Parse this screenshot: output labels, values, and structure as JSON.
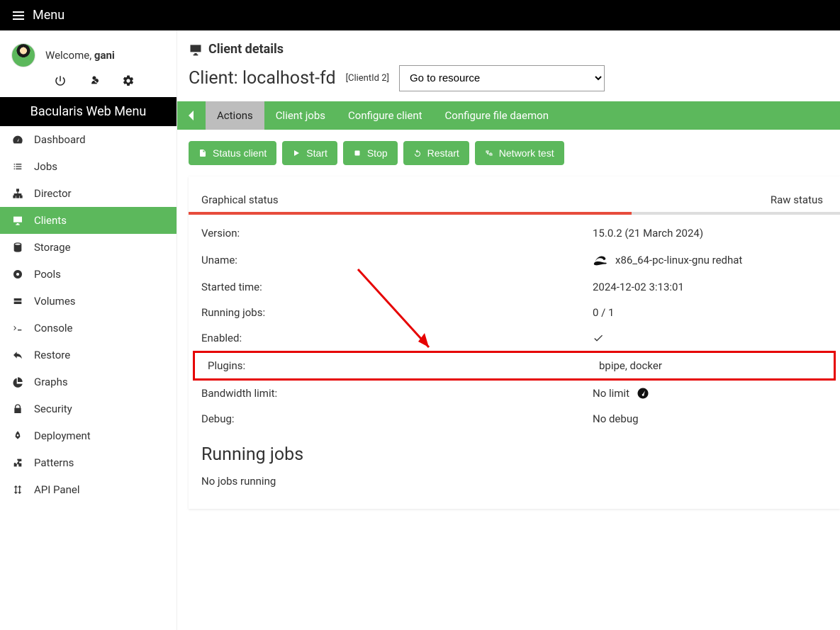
{
  "topbar": {
    "menu_label": "Menu"
  },
  "user": {
    "welcome_prefix": "Welcome, ",
    "name": "gani"
  },
  "sidebar": {
    "menu_title": "Bacularis Web Menu",
    "items": [
      {
        "label": "Dashboard",
        "icon": "tachometer"
      },
      {
        "label": "Jobs",
        "icon": "list"
      },
      {
        "label": "Director",
        "icon": "sitemap"
      },
      {
        "label": "Clients",
        "icon": "desktop",
        "active": true
      },
      {
        "label": "Storage",
        "icon": "database"
      },
      {
        "label": "Pools",
        "icon": "tape"
      },
      {
        "label": "Volumes",
        "icon": "hdd"
      },
      {
        "label": "Console",
        "icon": "terminal"
      },
      {
        "label": "Restore",
        "icon": "reply"
      },
      {
        "label": "Graphs",
        "icon": "chart-pie"
      },
      {
        "label": "Security",
        "icon": "lock"
      },
      {
        "label": "Deployment",
        "icon": "rocket"
      },
      {
        "label": "Patterns",
        "icon": "puzzle"
      },
      {
        "label": "API Panel",
        "icon": "arrows-v"
      }
    ]
  },
  "page": {
    "title": "Client details",
    "client_label": "Client: ",
    "client_name": "localhost-fd",
    "client_id": "[ClientId 2]",
    "go_to_resource": "Go to resource"
  },
  "tabs": {
    "items": [
      {
        "label": "Actions",
        "active": true
      },
      {
        "label": "Client jobs"
      },
      {
        "label": "Configure client"
      },
      {
        "label": "Configure file daemon"
      }
    ]
  },
  "actions": {
    "status_client": "Status client",
    "start": "Start",
    "stop": "Stop",
    "restart": "Restart",
    "network_test": "Network test"
  },
  "status_tabs": {
    "graphical": "Graphical status",
    "raw": "Raw status"
  },
  "info": {
    "version_label": "Version:",
    "version_value": "15.0.2 (21 March 2024)",
    "uname_label": "Uname:",
    "uname_value": "x86_64-pc-linux-gnu redhat",
    "started_label": "Started time:",
    "started_value": "2024-12-02 3:13:01",
    "running_label": "Running jobs:",
    "running_value": "0 / 1",
    "enabled_label": "Enabled:",
    "plugins_label": "Plugins:",
    "plugins_value": "bpipe, docker",
    "bandwidth_label": "Bandwidth limit:",
    "bandwidth_value": "No limit",
    "debug_label": "Debug:",
    "debug_value": "No debug"
  },
  "running_jobs": {
    "title": "Running jobs",
    "empty": "No jobs running"
  }
}
